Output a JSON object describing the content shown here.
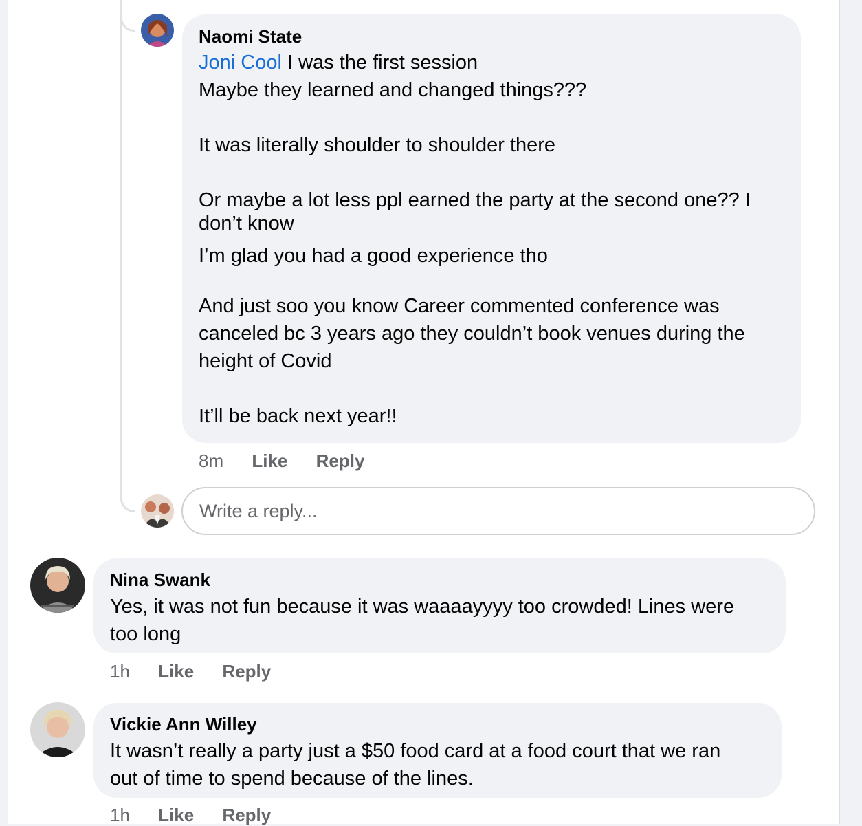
{
  "reply_comment": {
    "author": "Naomi State",
    "mention": "Joni Cool",
    "first_line_rest": " I was the first session",
    "lines": [
      "Maybe they learned and changed things???",
      "It was literally shoulder to shoulder there",
      "Or maybe a lot less ppl earned the party at the second one?? I",
      "don’t know",
      "I’m glad you had a good experience tho",
      "And just soo you know Career commented conference was",
      "canceled bc 3 years ago they couldn’t book venues during the",
      "height of Covid",
      "It’ll be back next year!!"
    ],
    "time": "8m",
    "like_label": "Like",
    "reply_label": "Reply"
  },
  "reply_box": {
    "placeholder": "Write a reply..."
  },
  "comments": [
    {
      "author": "Nina Swank",
      "lines": [
        "Yes, it was not fun because it was waaaayyyy too crowded! Lines were",
        "too long"
      ],
      "time": "1h",
      "like_label": "Like",
      "reply_label": "Reply"
    },
    {
      "author": "Vickie Ann Willey",
      "lines": [
        "It wasn’t really a party just a $50 food card at a food court that we ran",
        "out of time to spend because of the lines."
      ],
      "time": "1h",
      "like_label": "Like",
      "reply_label": "Reply"
    }
  ],
  "colors": {
    "bubble": "#f0f2f5",
    "mention": "#1a6ed8",
    "meta": "#65676b"
  },
  "icons": [
    "avatar-naomi-state",
    "avatar-current-user",
    "avatar-nina-swank",
    "avatar-vickie-ann-willey"
  ]
}
